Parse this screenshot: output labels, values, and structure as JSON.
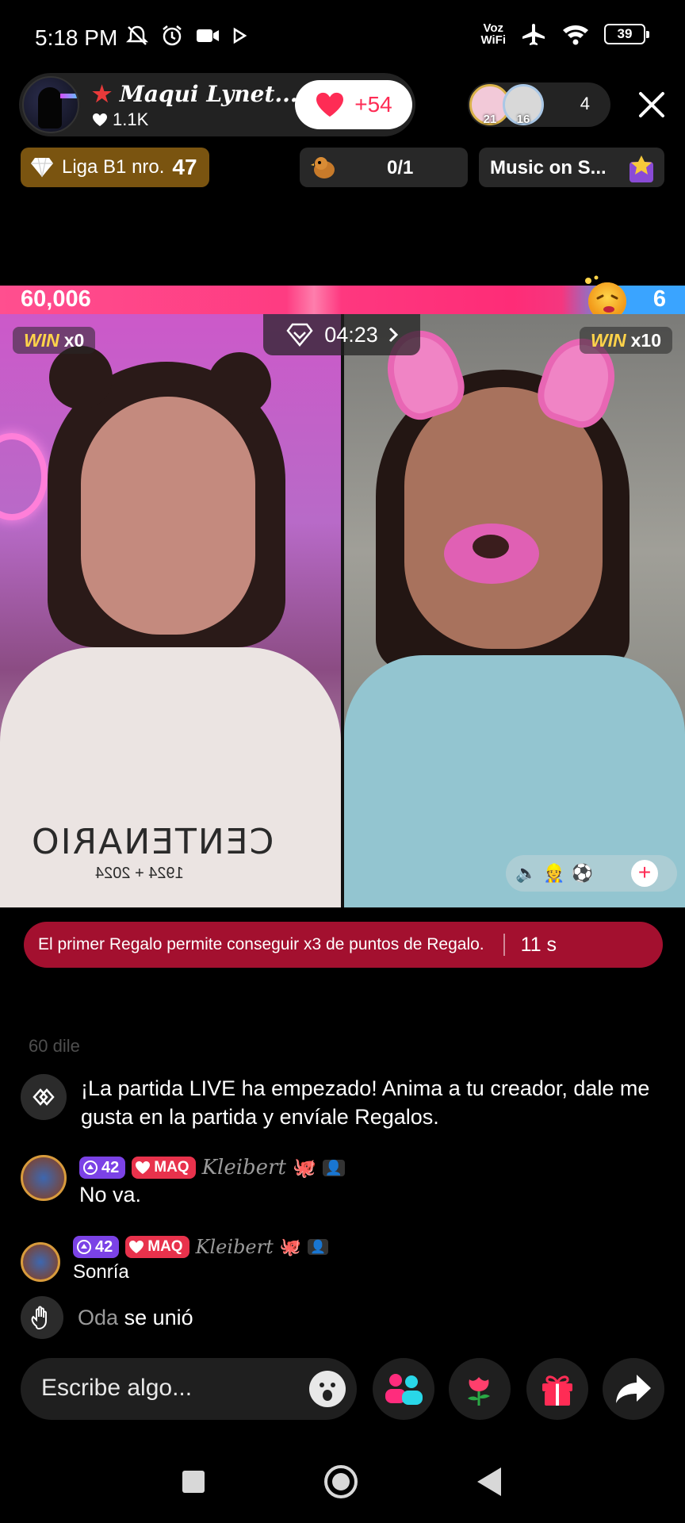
{
  "status_bar": {
    "time": "5:18 PM",
    "voz_wifi": [
      "Voz",
      "WiFi"
    ],
    "battery": "39",
    "icons": [
      "mute-icon",
      "alarm-icon",
      "video-icon",
      "play-icon",
      "airplane-icon",
      "wifi-icon",
      "battery-icon"
    ]
  },
  "host": {
    "name": "Maqui Lynet...",
    "likes": "1.1K",
    "like_count": "+54"
  },
  "viewers": {
    "avatars": [
      {
        "badge": "21"
      },
      {
        "badge": "16"
      }
    ],
    "count": "4"
  },
  "chips": {
    "league_label": "Liga B1 nro.",
    "league_number": "47",
    "quest_progress": "0/1",
    "music": "Music on S..."
  },
  "battle": {
    "score_left": "60,006",
    "score_right": "6",
    "left_share": 0.835,
    "timer": "04:23",
    "win_left_label": "WIN",
    "win_left_count": "x0",
    "win_right_label": "WIN",
    "win_right_count": "x10",
    "left_shirt_text": "CENTENARIO",
    "left_shirt_sub": "1924 + 2024"
  },
  "banner": {
    "text": "El primer Regalo permite conseguir x3 de puntos de Regalo.",
    "countdown": "11 s"
  },
  "chat": {
    "faded": "60 dile",
    "system_message": "¡La partida LIVE ha empezado! Anima a tu creador, dale me gusta en la partida y envíale Regalos.",
    "messages": [
      {
        "level": "42",
        "tag": "MAQ",
        "user": "Kleibert",
        "text": "No va."
      },
      {
        "level": "42",
        "tag": "MAQ",
        "user": "Kleibert",
        "text": "Sonría"
      }
    ],
    "join_user": "Oda",
    "join_text": "se unió"
  },
  "input": {
    "placeholder": "Escribe algo..."
  },
  "colors": {
    "brand_pink": "#fe2c55",
    "score_blue": "#3aa4ff",
    "banner_red": "#a3102f",
    "league_gold": "#7a5410"
  }
}
